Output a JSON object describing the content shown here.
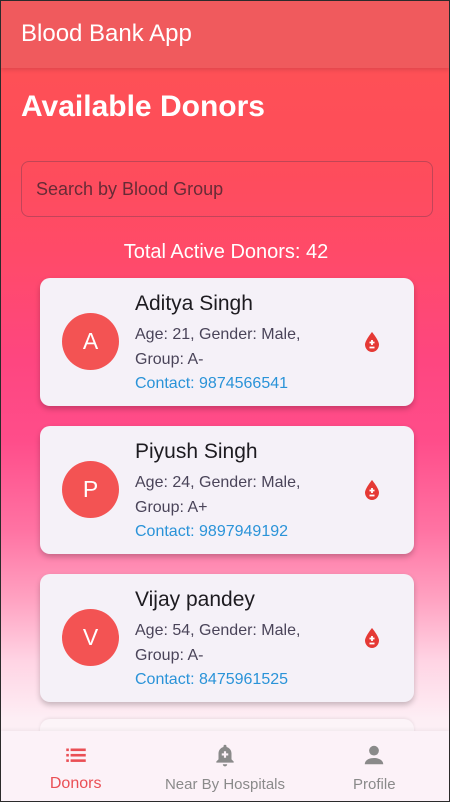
{
  "app_bar": {
    "title": "Blood Bank App"
  },
  "page": {
    "title": "Available Donors"
  },
  "search": {
    "placeholder": "Search by Blood Group",
    "value": ""
  },
  "summary": {
    "total_text": "Total Active Donors: 42"
  },
  "donors": [
    {
      "initial": "A",
      "name": "Aditya Singh",
      "details": "Age: 21, Gender: Male, Group: A-",
      "contact": "Contact: 9874566541"
    },
    {
      "initial": "P",
      "name": "Piyush Singh",
      "details": "Age: 24, Gender: Male, Group: A+",
      "contact": "Contact: 9897949192"
    },
    {
      "initial": "V",
      "name": "Vijay pandey",
      "details": "Age: 54, Gender: Male, Group: A-",
      "contact": "Contact: 8475961525"
    }
  ],
  "bottom_nav": {
    "items": [
      {
        "label": "Donors",
        "icon": "list-icon",
        "active": true
      },
      {
        "label": "Near By Hospitals",
        "icon": "add-alert-bell-icon",
        "active": false
      },
      {
        "label": "Profile",
        "icon": "person-icon",
        "active": false
      }
    ]
  },
  "colors": {
    "app_bar": "#f05a5d",
    "avatar": "#f35353",
    "contact_link": "#2a93d8",
    "active_nav": "#ea4f55",
    "blood_icon": "#e53935"
  }
}
